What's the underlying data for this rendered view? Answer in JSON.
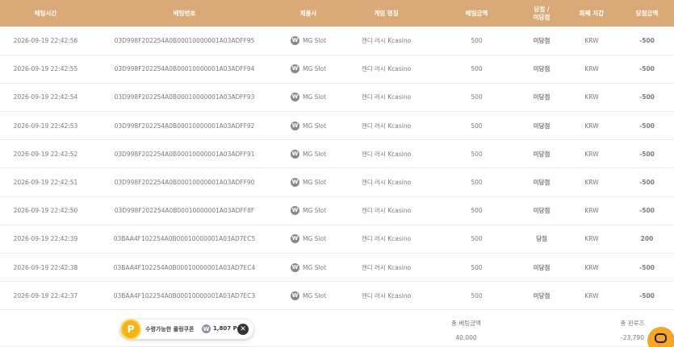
{
  "table": {
    "headers": {
      "time": "베팅시간",
      "bet_id": "베팅번호",
      "provider": "제품사",
      "game": "게임 명칭",
      "amount": "베팅금액",
      "result_line1": "당첨 /",
      "result_line2": "미당첨",
      "currency": "화폐 지갑",
      "win": "당첨금액"
    },
    "rows": [
      {
        "time": "2026-09-19 22:42:56",
        "bet_id": "03D998F202254A0B00010000001A03ADFF95",
        "provider": "MG Slot",
        "game": "캔디 러시 Kcasino",
        "amount": "500",
        "result": "미당첨",
        "currency": "KRW",
        "win": "-500"
      },
      {
        "time": "2026-09-19 22:42:55",
        "bet_id": "03D998F202254A0B00010000001A03ADFF94",
        "provider": "MG Slot",
        "game": "캔디 러시 Kcasino",
        "amount": "500",
        "result": "미당첨",
        "currency": "KRW",
        "win": "-500"
      },
      {
        "time": "2026-09-19 22:42:54",
        "bet_id": "03D998F202254A0B00010000001A03ADFF93",
        "provider": "MG Slot",
        "game": "캔디 러시 Kcasino",
        "amount": "500",
        "result": "미당첨",
        "currency": "KRW",
        "win": "-500"
      },
      {
        "time": "2026-09-19 22:42:53",
        "bet_id": "03D998F202254A0B00010000001A03ADFF92",
        "provider": "MG Slot",
        "game": "캔디 러시 Kcasino",
        "amount": "500",
        "result": "미당첨",
        "currency": "KRW",
        "win": "-500"
      },
      {
        "time": "2026-09-19 22:42:52",
        "bet_id": "03D998F202254A0B00010000001A03ADFF91",
        "provider": "MG Slot",
        "game": "캔디 러시 Kcasino",
        "amount": "500",
        "result": "미당첨",
        "currency": "KRW",
        "win": "-500"
      },
      {
        "time": "2026-09-19 22:42:51",
        "bet_id": "03D998F202254A0B00010000001A03ADFF90",
        "provider": "MG Slot",
        "game": "캔디 러시 Kcasino",
        "amount": "500",
        "result": "미당첨",
        "currency": "KRW",
        "win": "-500"
      },
      {
        "time": "2026-09-19 22:42:50",
        "bet_id": "03D998F202254A0B00010000001A03ADFF8F",
        "provider": "MG Slot",
        "game": "캔디 러시 Kcasino",
        "amount": "500",
        "result": "미당첨",
        "currency": "KRW",
        "win": "-500"
      },
      {
        "time": "2026-09-19 22:42:39",
        "bet_id": "03BAA4F102254A0B00010000001A03AD7EC5",
        "provider": "MG Slot",
        "game": "캔디 러시 Kcasino",
        "amount": "500",
        "result": "당첨",
        "currency": "KRW",
        "win": "200"
      },
      {
        "time": "2026-09-19 22:42:38",
        "bet_id": "03BAA4F102254A0B00010000001A03AD7EC4",
        "provider": "MG Slot",
        "game": "캔디 러시 Kcasino",
        "amount": "500",
        "result": "미당첨",
        "currency": "KRW",
        "win": "-500"
      },
      {
        "time": "2026-09-19 22:42:37",
        "bet_id": "03BAA4F102254A0B00010000001A03AD7EC3",
        "provider": "MG Slot",
        "game": "캔디 러시 Kcasino",
        "amount": "500",
        "result": "미당첨",
        "currency": "KRW",
        "win": "-500"
      }
    ],
    "result_win_value": "당첨"
  },
  "summary": {
    "total_bet_label": "총 베팅금액",
    "total_bet_value": "40,000",
    "total_win_label": "총 윈루즈",
    "total_win_value": "-23,790"
  },
  "coupon": {
    "badge": "P",
    "label": "수령가능한 롤링쿠폰",
    "currency_icon_glyph": "W",
    "points": "1,807 P",
    "close_glyph": "✕"
  },
  "provider_icon_glyph": "W",
  "colors": {
    "header_bg": "#d9a978",
    "lose": "#e8334a",
    "win": "#2fbf3a",
    "coupon_badge": "#f5b21b",
    "chat_button": "#f5a623"
  },
  "icons": {
    "provider": "mg-provider-icon",
    "coupon_badge": "point-coin-icon",
    "currency": "won-coin-icon",
    "close": "close-icon",
    "chat": "chat-bubble-icon"
  }
}
